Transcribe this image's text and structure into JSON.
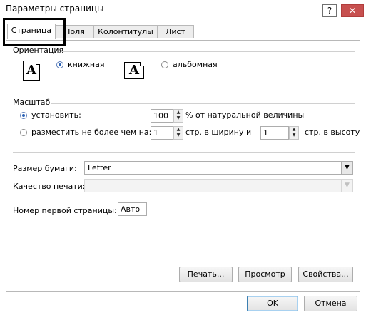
{
  "window": {
    "title": "Параметры страницы",
    "help_label": "?",
    "close_label": "✕"
  },
  "tabs": [
    {
      "label": "Страница"
    },
    {
      "label": "Поля"
    },
    {
      "label": "Колонтитулы"
    },
    {
      "label": "Лист"
    }
  ],
  "orientation": {
    "title": "Ориентация",
    "portrait_icon_text": "A",
    "portrait_label": "книжная",
    "landscape_icon_text": "A",
    "landscape_label": "альбомная",
    "selected": "portrait"
  },
  "scaling": {
    "title": "Масштаб",
    "adjust_label": "установить:",
    "adjust_value": "100",
    "adjust_suffix": "% от натуральной величины",
    "fit_label": "разместить не более чем на:",
    "fit_wide_value": "1",
    "fit_wide_suffix": "стр. в ширину и",
    "fit_tall_value": "1",
    "fit_tall_suffix": "стр. в высоту",
    "selected": "adjust"
  },
  "paper_size": {
    "label": "Размер бумаги:",
    "value": "Letter"
  },
  "print_quality": {
    "label": "Качество печати:",
    "value": ""
  },
  "first_page": {
    "label": "Номер первой страницы:",
    "value": "Авто"
  },
  "buttons": {
    "print": "Печать...",
    "preview": "Просмотр",
    "options": "Свойства...",
    "ok": "OK",
    "cancel": "Отмена"
  },
  "icons": {
    "spin_up": "▲",
    "spin_down": "▼",
    "dropdown": "▼"
  }
}
